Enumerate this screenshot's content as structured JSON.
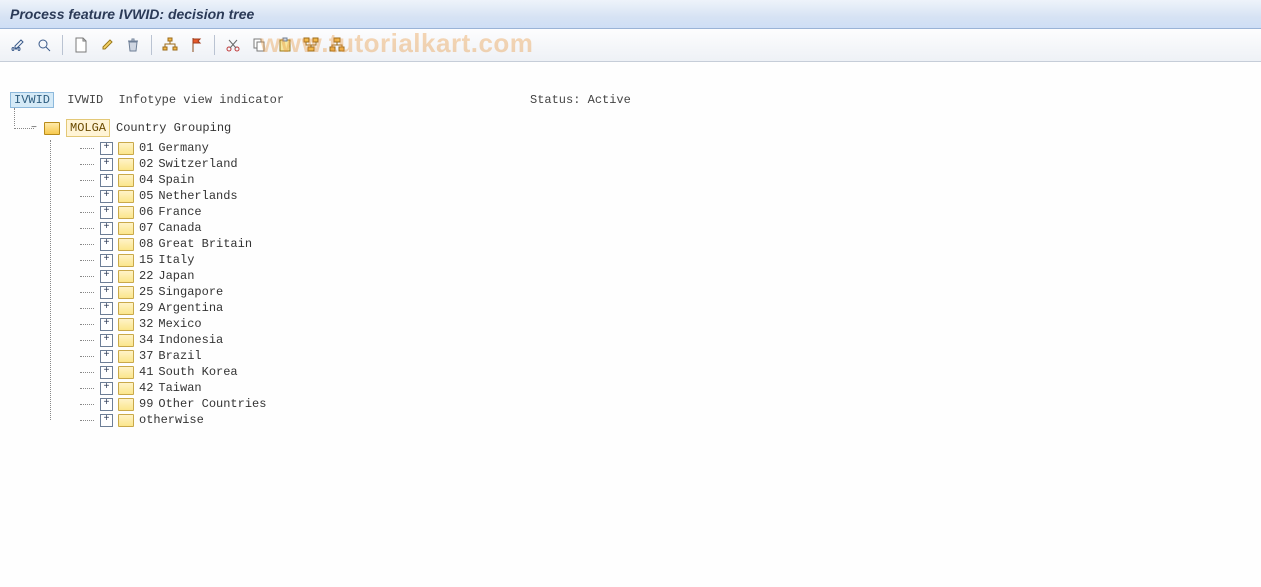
{
  "title": "Process feature IVWID: decision tree",
  "watermark": "www.tutorialkart.com",
  "toolbar": {
    "buttons": [
      {
        "name": "change-icon",
        "tip": "Change"
      },
      {
        "name": "check-icon",
        "tip": "Check"
      },
      {
        "sep": true
      },
      {
        "name": "create-icon",
        "tip": "Create"
      },
      {
        "name": "edit-icon",
        "tip": "Edit"
      },
      {
        "name": "delete-icon",
        "tip": "Delete"
      },
      {
        "sep": true
      },
      {
        "name": "hierarchy-icon",
        "tip": "Hierarchy"
      },
      {
        "name": "flag-icon",
        "tip": "Mark"
      },
      {
        "sep": true
      },
      {
        "name": "cut-icon",
        "tip": "Cut"
      },
      {
        "name": "copy-icon",
        "tip": "Copy"
      },
      {
        "name": "paste-icon",
        "tip": "Paste"
      },
      {
        "name": "expand-icon",
        "tip": "Expand"
      },
      {
        "name": "collapse-icon",
        "tip": "Collapse"
      }
    ]
  },
  "root": {
    "code": "IVWID",
    "code2": "IVWID",
    "desc": "Infotype view indicator",
    "status_label": "Status:",
    "status_value": "Active"
  },
  "molga": {
    "code": "MOLGA",
    "label": "Country Grouping"
  },
  "countries": [
    {
      "code": "01",
      "name": "Germany"
    },
    {
      "code": "02",
      "name": "Switzerland"
    },
    {
      "code": "04",
      "name": "Spain"
    },
    {
      "code": "05",
      "name": "Netherlands"
    },
    {
      "code": "06",
      "name": "France"
    },
    {
      "code": "07",
      "name": "Canada"
    },
    {
      "code": "08",
      "name": "Great Britain"
    },
    {
      "code": "15",
      "name": "Italy"
    },
    {
      "code": "22",
      "name": "Japan"
    },
    {
      "code": "25",
      "name": "Singapore"
    },
    {
      "code": "29",
      "name": "Argentina"
    },
    {
      "code": "32",
      "name": "Mexico"
    },
    {
      "code": "34",
      "name": "Indonesia"
    },
    {
      "code": "37",
      "name": "Brazil"
    },
    {
      "code": "41",
      "name": "South Korea"
    },
    {
      "code": "42",
      "name": "Taiwan"
    },
    {
      "code": "99",
      "name": "Other Countries"
    },
    {
      "code": "",
      "name": "otherwise"
    }
  ]
}
